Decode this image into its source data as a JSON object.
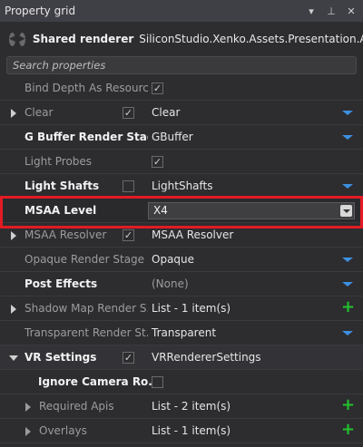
{
  "window": {
    "title": "Property grid",
    "buttons": {
      "menu": "▾",
      "pin": "⊥",
      "close": "✕"
    }
  },
  "header": {
    "object_type": "Shared renderer",
    "object_path": "SiliconStudio.Xenko.Assets.Presentation.Ass..."
  },
  "search": {
    "placeholder": "Search properties"
  },
  "rows": [
    {
      "name": "Bind Depth As Resourc...",
      "style": "dim",
      "checkbox_right": true,
      "checked_right": true
    },
    {
      "name": "Clear",
      "style": "dim",
      "expander": true,
      "checkbox_left": true,
      "checked_left": true,
      "value": "Clear",
      "dropdown": true
    },
    {
      "name": "G Buffer Render Stage",
      "style": "bold",
      "value": "GBuffer",
      "dropdown": true
    },
    {
      "name": "Light Probes",
      "style": "dim",
      "checkbox_right": true,
      "checked_right": true
    },
    {
      "name": "Light Shafts",
      "style": "bold",
      "checkbox_left": true,
      "checked_left": false,
      "value": "LightShafts",
      "dropdown": true
    },
    {
      "name": "MSAA Level",
      "style": "bold",
      "value": "X4",
      "combo": true
    },
    {
      "name": "MSAA Resolver",
      "style": "dim",
      "expander": true,
      "checkbox_left": true,
      "checked_left": true,
      "value": "MSAA Resolver"
    },
    {
      "name": "Opaque Render Stage",
      "style": "dim",
      "value": "Opaque",
      "dropdown": true
    },
    {
      "name": "Post Effects",
      "style": "bold",
      "value": "(None)",
      "value_style": "dim",
      "dropdown": true
    },
    {
      "name": "Shadow Map Render S...",
      "style": "dim",
      "expander": true,
      "value": "List - 1 item(s)",
      "plus": true
    },
    {
      "name": "Transparent Render St...",
      "style": "dim",
      "value": "Transparent",
      "dropdown": true
    },
    {
      "name": "VR Settings",
      "style": "bold",
      "expander": true,
      "expander_open": true,
      "checkbox_left": true,
      "checked_left": true,
      "value": "VRRendererSettings",
      "section": true
    },
    {
      "name": "Ignore Camera Ro...",
      "style": "bold",
      "indent": 1,
      "checkbox_right": true,
      "checked_right": false
    },
    {
      "name": "Required Apis",
      "style": "dim",
      "indent": 1,
      "expander": true,
      "value": "List - 2 item(s)",
      "plus": true
    },
    {
      "name": "Overlays",
      "style": "dim",
      "indent": 1,
      "expander": true,
      "value": "List - 1 item(s)",
      "plus": true
    }
  ],
  "glyphs": {
    "check": "✓",
    "plus": "+"
  },
  "colors": {
    "accent_blue": "#3d8fe0",
    "add_green": "#22c32e",
    "highlight_red": "#e31b23"
  }
}
